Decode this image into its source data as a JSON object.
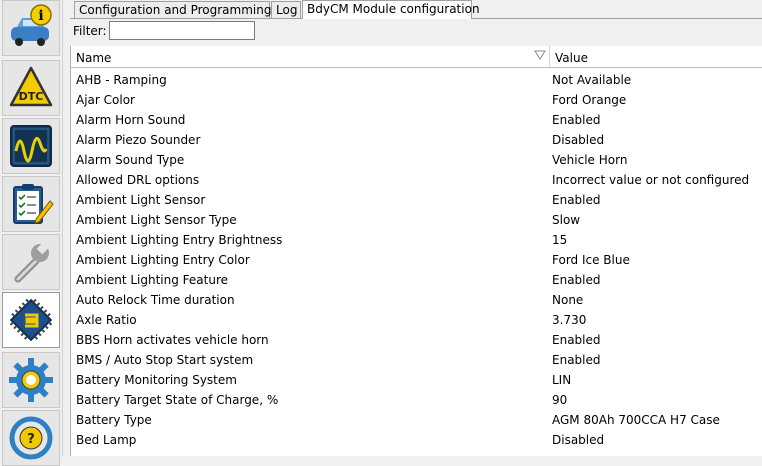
{
  "tabs": [
    {
      "label": "Configuration and Programming",
      "active": false
    },
    {
      "label": "Log",
      "active": false
    },
    {
      "label": "BdyCM Module configuration",
      "active": true
    }
  ],
  "filter": {
    "label": "Filter:",
    "value": ""
  },
  "grid": {
    "columns": {
      "name": "Name",
      "value": "Value"
    },
    "rows": [
      {
        "name": "AHB - Ramping",
        "value": "Not Available"
      },
      {
        "name": "Ajar Color",
        "value": "Ford Orange"
      },
      {
        "name": "Alarm Horn Sound",
        "value": "Enabled"
      },
      {
        "name": "Alarm Piezo Sounder",
        "value": "Disabled"
      },
      {
        "name": "Alarm Sound Type",
        "value": "Vehicle Horn"
      },
      {
        "name": "Allowed DRL options",
        "value": "Incorrect value or not configured"
      },
      {
        "name": "Ambient Light Sensor",
        "value": "Enabled"
      },
      {
        "name": "Ambient Light Sensor Type",
        "value": "Slow"
      },
      {
        "name": "Ambient Lighting Entry Brightness",
        "value": "15"
      },
      {
        "name": "Ambient Lighting Entry Color",
        "value": "Ford Ice Blue"
      },
      {
        "name": "Ambient Lighting Feature",
        "value": "Enabled"
      },
      {
        "name": "Auto Relock Time duration",
        "value": "None"
      },
      {
        "name": "Axle Ratio",
        "value": "3.730"
      },
      {
        "name": "BBS Horn activates vehicle horn",
        "value": "Enabled"
      },
      {
        "name": "BMS / Auto Stop Start system",
        "value": "Enabled"
      },
      {
        "name": "Battery Monitoring System",
        "value": "LIN"
      },
      {
        "name": "Battery Target State of Charge, %",
        "value": "90"
      },
      {
        "name": "Battery Type",
        "value": "AGM 80Ah 700CCA H7 Case"
      },
      {
        "name": "Bed Lamp",
        "value": "Disabled"
      }
    ]
  },
  "sidebar": {
    "items": [
      {
        "icon": "car-info-icon"
      },
      {
        "icon": "dtc-warning-icon"
      },
      {
        "icon": "oscilloscope-icon"
      },
      {
        "icon": "checklist-icon"
      },
      {
        "icon": "wrench-icon"
      },
      {
        "icon": "module-chip-icon",
        "active": true
      },
      {
        "icon": "gear-icon"
      },
      {
        "icon": "steering-help-icon"
      }
    ]
  }
}
